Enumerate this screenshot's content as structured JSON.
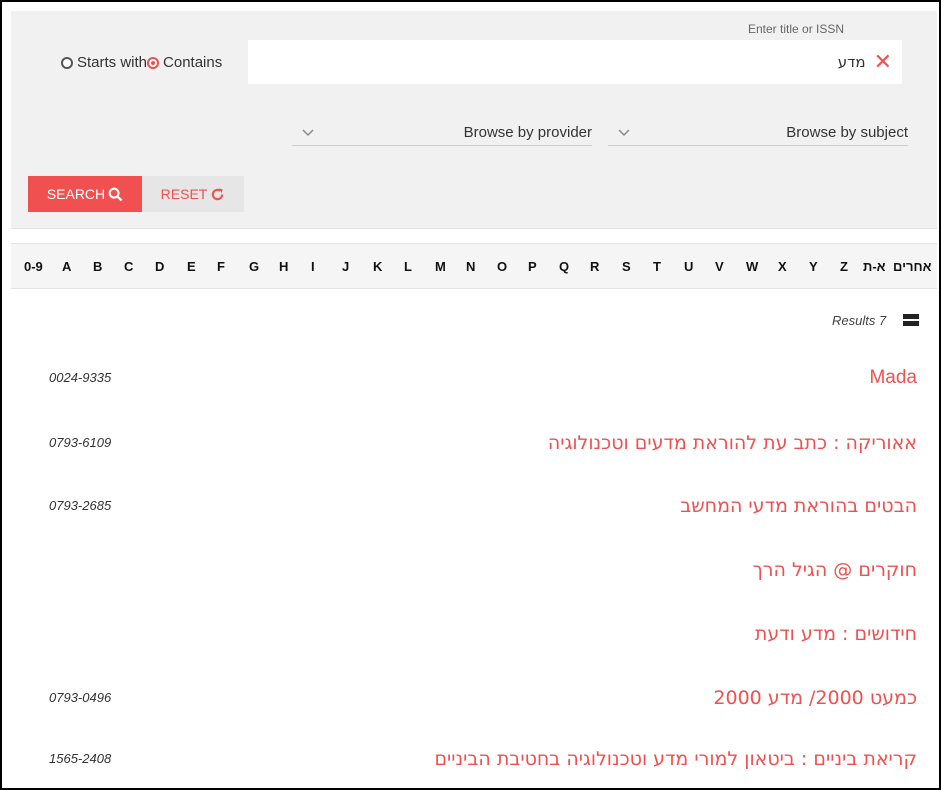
{
  "search": {
    "field_label": "Enter title or ISSN",
    "query": "מדע",
    "radio_starts_with": "Starts with",
    "radio_contains": "Contains",
    "selected_mode": "contains",
    "browse_provider": "Browse by provider",
    "browse_subject": "Browse by subject",
    "search_button": "SEARCH",
    "reset_button": "RESET"
  },
  "alphabet": [
    "0-9",
    "A",
    "B",
    "C",
    "D",
    "E",
    "F",
    "G",
    "H",
    "I",
    "J",
    "K",
    "L",
    "M",
    "N",
    "O",
    "P",
    "Q",
    "R",
    "S",
    "T",
    "U",
    "V",
    "W",
    "X",
    "Y",
    "Z",
    "א-ת",
    "אחרים"
  ],
  "results": {
    "count_text": "Results 7",
    "items": [
      {
        "title": "Mada",
        "issn": "0024-9335"
      },
      {
        "title": "אאוריקה : כתב עת להוראת מדעים וטכנולוגיה",
        "issn": "0793-6109"
      },
      {
        "title": "הבטים בהוראת מדעי המחשב",
        "issn": "0793-2685"
      },
      {
        "title": "חוקרים @ הגיל הרך",
        "issn": ""
      },
      {
        "title": "חידושים : מדע ודעת",
        "issn": ""
      },
      {
        "title": "כמעט 2000/ מדע 2000",
        "issn": "0793-0496"
      },
      {
        "title": "קריאת ביניים : ביטאון למורי מדע וטכנולוגיה בחטיבת הביניים",
        "issn": "1565-2408"
      }
    ]
  },
  "colors": {
    "accent": "#f0504f",
    "panel": "#f1f1f1"
  },
  "icons": {
    "clear": "close-icon",
    "search": "search-icon",
    "reset": "refresh-icon",
    "view": "list-view-icon",
    "dropdown": "chevron-down-icon"
  }
}
